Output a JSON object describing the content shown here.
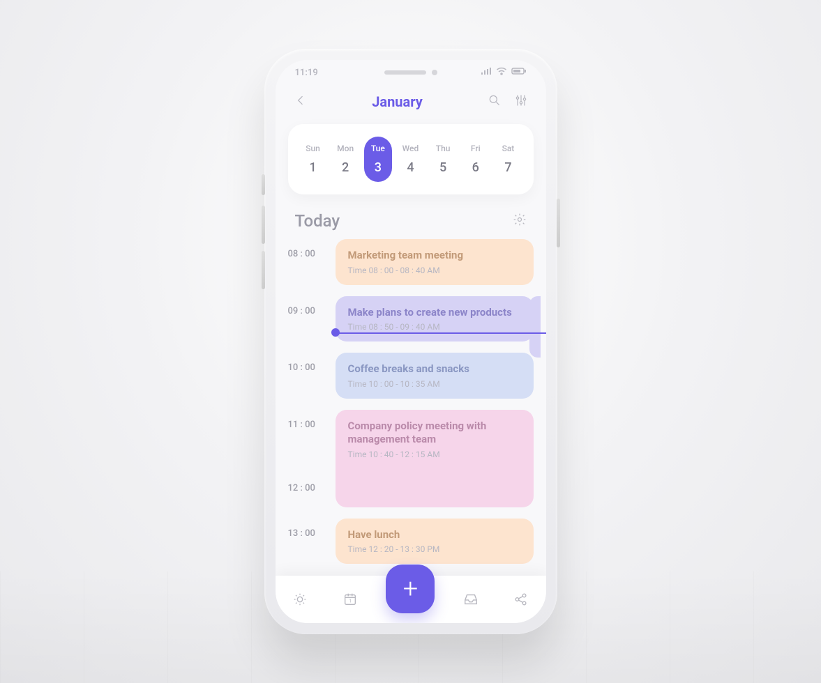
{
  "status": {
    "time": "11:19"
  },
  "header": {
    "title": "January"
  },
  "week": {
    "days": [
      {
        "label": "Sun",
        "num": "1",
        "selected": false
      },
      {
        "label": "Mon",
        "num": "2",
        "selected": false
      },
      {
        "label": "Tue",
        "num": "3",
        "selected": true
      },
      {
        "label": "Wed",
        "num": "4",
        "selected": false
      },
      {
        "label": "Thu",
        "num": "5",
        "selected": false
      },
      {
        "label": "Fri",
        "num": "6",
        "selected": false
      },
      {
        "label": "Sat",
        "num": "7",
        "selected": false
      }
    ]
  },
  "section": {
    "title": "Today"
  },
  "timeline": {
    "slots": [
      {
        "time": "08 : 00",
        "title": "Marketing team meeting",
        "sub": "Time 08 : 00 - 08 : 40 AM",
        "color": "orange",
        "tall": false,
        "now": false
      },
      {
        "time": "09 : 00",
        "title": "Make plans to create new products",
        "sub": "Time 08 : 50 - 09 : 40 AM",
        "color": "purple",
        "tall": false,
        "now": true
      },
      {
        "time": "10 : 00",
        "title": "Coffee breaks and snacks",
        "sub": "Time 10 : 00 - 10 : 35 AM",
        "color": "blue",
        "tall": false,
        "now": false
      },
      {
        "time": "11 : 00",
        "title": "Company policy meeting with management team",
        "sub": "Time 10 : 40 - 12 : 15 AM",
        "color": "pink",
        "tall": true,
        "now": false
      },
      {
        "time": "12 : 00",
        "title": "",
        "sub": "",
        "color": "",
        "tall": false,
        "now": false
      },
      {
        "time": "13 : 00",
        "title": "Have lunch",
        "sub": "Time 12 : 20 - 13 : 30 PM",
        "color": "orange",
        "tall": false,
        "now": false
      }
    ]
  }
}
